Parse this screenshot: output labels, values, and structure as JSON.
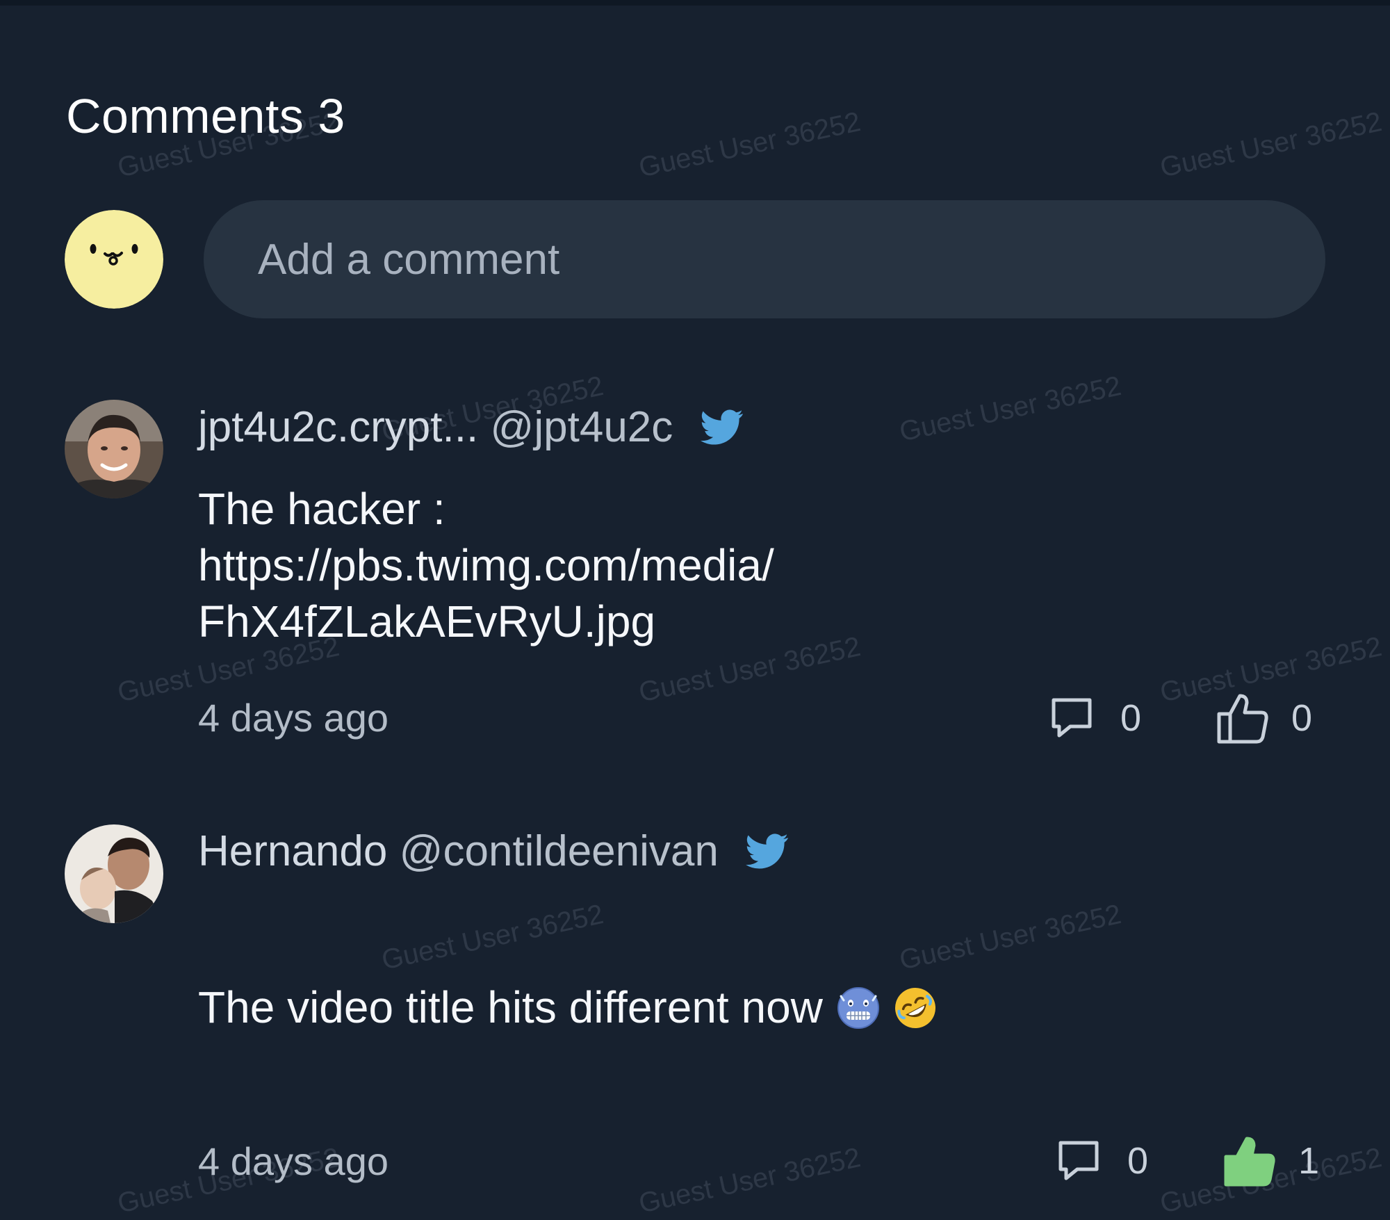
{
  "heading": "Comments 3",
  "composer": {
    "placeholder": "Add a comment"
  },
  "watermark": "Guest User 36252",
  "comments": [
    {
      "author": "jpt4u2c.crypt...",
      "handle": "@jpt4u2c",
      "text": "The hacker :\nhttps://pbs.twimg.com/media/\nFhX4fZLakAEvRyU.jpg",
      "time": "4 days ago",
      "reply_count": "0",
      "like_count": "0",
      "liked": false
    },
    {
      "author": "Hernando",
      "handle": "@contildeenivan",
      "text": "The video title hits different now",
      "emojis": [
        "cold-face-emoji",
        "rolling-on-the-floor-laughing-emoji"
      ],
      "time": "4 days ago",
      "reply_count": "0",
      "like_count": "1",
      "liked": true
    }
  ],
  "colors": {
    "background": "#17212f",
    "input": "#273341",
    "twitter": "#55a6de",
    "liked": "#7fd07f",
    "avatar_guest": "#f6eea0"
  }
}
